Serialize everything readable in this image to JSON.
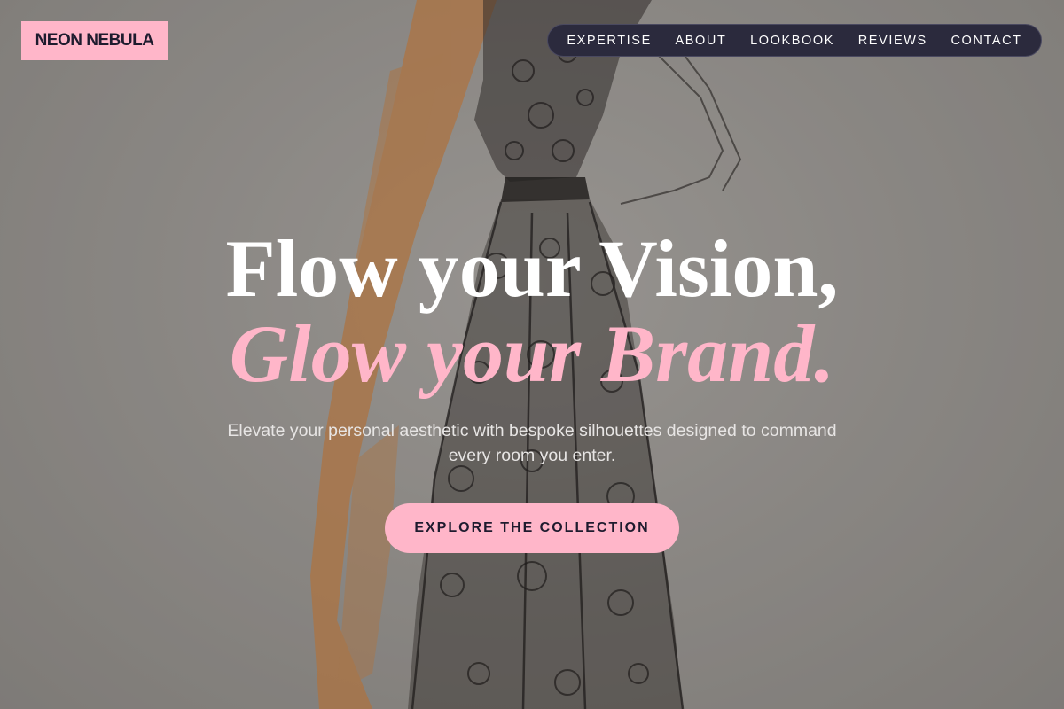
{
  "brand": {
    "name": "NEON NEBULA"
  },
  "nav": {
    "items": [
      {
        "label": "EXPERTISE"
      },
      {
        "label": "ABOUT"
      },
      {
        "label": "LOOKBOOK"
      },
      {
        "label": "REVIEWS"
      },
      {
        "label": "CONTACT"
      }
    ]
  },
  "hero": {
    "headline_line1": "Flow your Vision,",
    "headline_line2": "Glow your Brand.",
    "subtext": "Elevate your personal aesthetic with bespoke silhouettes designed to command every room you enter.",
    "cta_label": "EXPLORE THE COLLECTION",
    "background_image": "fashion-sketch-lace-dress"
  },
  "colors": {
    "accent_pink": "#ffb6c9",
    "nav_bg": "#2b2a3d",
    "text_dark": "#1e1b2e",
    "sketch_orange": "#d98a45"
  }
}
